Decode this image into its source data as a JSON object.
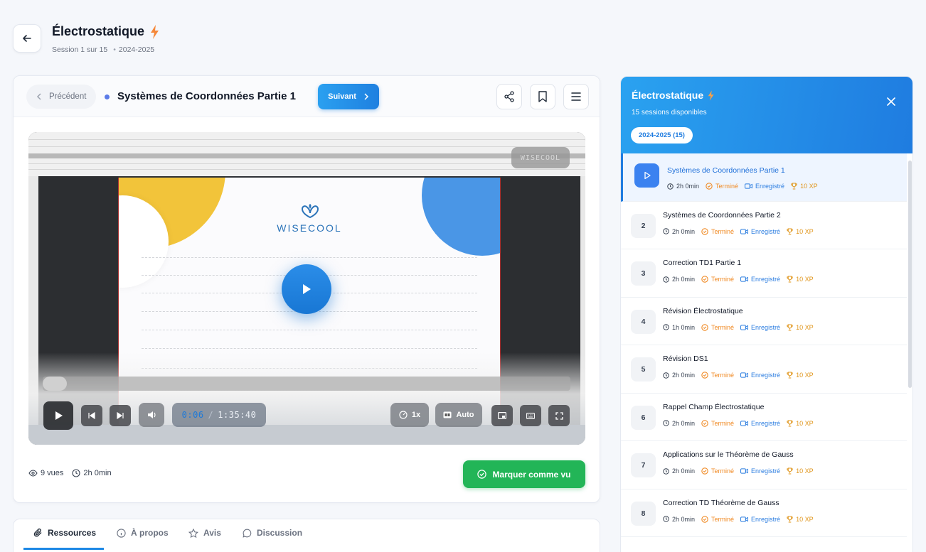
{
  "header": {
    "title": "Électrostatique",
    "session": "Session 1 sur 15",
    "year": "2024-2025"
  },
  "lesson": {
    "prev_label": "Précédent",
    "title": "Systèmes de Coordonnées Partie 1",
    "next_label": "Suivant"
  },
  "video": {
    "watermark": "WISECOOL",
    "brand": "WISECOOL",
    "current_time": "0:06",
    "separator": "/",
    "total_time": "1:35:40",
    "speed": "1x",
    "quality": "Auto",
    "progress": 0.001
  },
  "meta": {
    "views": "9 vues",
    "duration": "2h 0min"
  },
  "mark_button": "Marquer comme vu",
  "tabs": [
    {
      "label": "Ressources"
    },
    {
      "label": "À propos"
    },
    {
      "label": "Avis"
    },
    {
      "label": "Discussion"
    }
  ],
  "sidebar": {
    "title": "Électrostatique",
    "subtitle": "15 sessions disponibles",
    "chip": "2024-2025 (15)",
    "items": [
      {
        "num": "",
        "title": "Systèmes de Coordonnées Partie 1",
        "time": "2h 0min",
        "status": "Terminé",
        "rec": "Enregistré",
        "xp": "10 XP"
      },
      {
        "num": "2",
        "title": "Systèmes de Coordonnées Partie 2",
        "time": "2h 0min",
        "status": "Terminé",
        "rec": "Enregistré",
        "xp": "10 XP"
      },
      {
        "num": "3",
        "title": "Correction TD1 Partie 1",
        "time": "2h 0min",
        "status": "Terminé",
        "rec": "Enregistré",
        "xp": "10 XP"
      },
      {
        "num": "4",
        "title": "Révision Électrostatique",
        "time": "1h 0min",
        "status": "Terminé",
        "rec": "Enregistré",
        "xp": "10 XP"
      },
      {
        "num": "5",
        "title": "Révision DS1",
        "time": "2h 0min",
        "status": "Terminé",
        "rec": "Enregistré",
        "xp": "10 XP"
      },
      {
        "num": "6",
        "title": "Rappel Champ Électrostatique",
        "time": "2h 0min",
        "status": "Terminé",
        "rec": "Enregistré",
        "xp": "10 XP"
      },
      {
        "num": "7",
        "title": "Applications sur le Théorème de Gauss",
        "time": "2h 0min",
        "status": "Terminé",
        "rec": "Enregistré",
        "xp": "10 XP"
      },
      {
        "num": "8",
        "title": "Correction TD Théorème de Gauss",
        "time": "2h 0min",
        "status": "Terminé",
        "rec": "Enregistré",
        "xp": "10 XP"
      }
    ]
  },
  "colors": {
    "accent": "#1f7ce0",
    "success": "#22b557",
    "warning": "#f08a24",
    "xp": "#e0951a"
  }
}
